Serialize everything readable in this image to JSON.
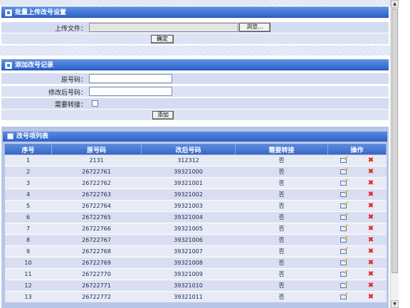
{
  "batch_panel": {
    "title": "批量上传改号设置",
    "upload_label": "上传文件：",
    "upload_value": "",
    "browse_label": "浏览...",
    "confirm_label": "确定"
  },
  "add_panel": {
    "title": "添加改号记录",
    "orig_label": "原号码：",
    "orig_value": "",
    "new_label": "修改后号码：",
    "new_value": "",
    "need_label": "需要转接：",
    "add_label": "添加"
  },
  "list_panel": {
    "title": "改号项列表",
    "headers": [
      "序号",
      "原号码",
      "改后号码",
      "需要转接",
      "操作"
    ],
    "rows": [
      {
        "seq": "1",
        "orig": "2131",
        "new": "312312",
        "need": "否"
      },
      {
        "seq": "2",
        "orig": "26722761",
        "new": "39321000",
        "need": "否"
      },
      {
        "seq": "3",
        "orig": "26722762",
        "new": "39321001",
        "need": "否"
      },
      {
        "seq": "4",
        "orig": "26722763",
        "new": "39321002",
        "need": "否"
      },
      {
        "seq": "5",
        "orig": "26722764",
        "new": "39321003",
        "need": "否"
      },
      {
        "seq": "6",
        "orig": "26722765",
        "new": "39321004",
        "need": "否"
      },
      {
        "seq": "7",
        "orig": "26722766",
        "new": "39321005",
        "need": "否"
      },
      {
        "seq": "8",
        "orig": "26722767",
        "new": "39321006",
        "need": "否"
      },
      {
        "seq": "9",
        "orig": "26722768",
        "new": "39321007",
        "need": "否"
      },
      {
        "seq": "10",
        "orig": "26722769",
        "new": "39321008",
        "need": "否"
      },
      {
        "seq": "11",
        "orig": "26722770",
        "new": "39321009",
        "need": "否"
      },
      {
        "seq": "12",
        "orig": "26722771",
        "new": "39321010",
        "need": "否"
      },
      {
        "seq": "13",
        "orig": "26722772",
        "new": "39321011",
        "need": "否"
      }
    ],
    "edit_icon": "edit-icon",
    "delete_icon": "delete-icon"
  },
  "scrollbar": {
    "up_icon": "scroll-up-icon",
    "down_icon": "scroll-down-icon"
  },
  "colors": {
    "title_bar": "#2a63c9",
    "row_bg": "#d5dcf1",
    "delete": "#e0201b"
  }
}
